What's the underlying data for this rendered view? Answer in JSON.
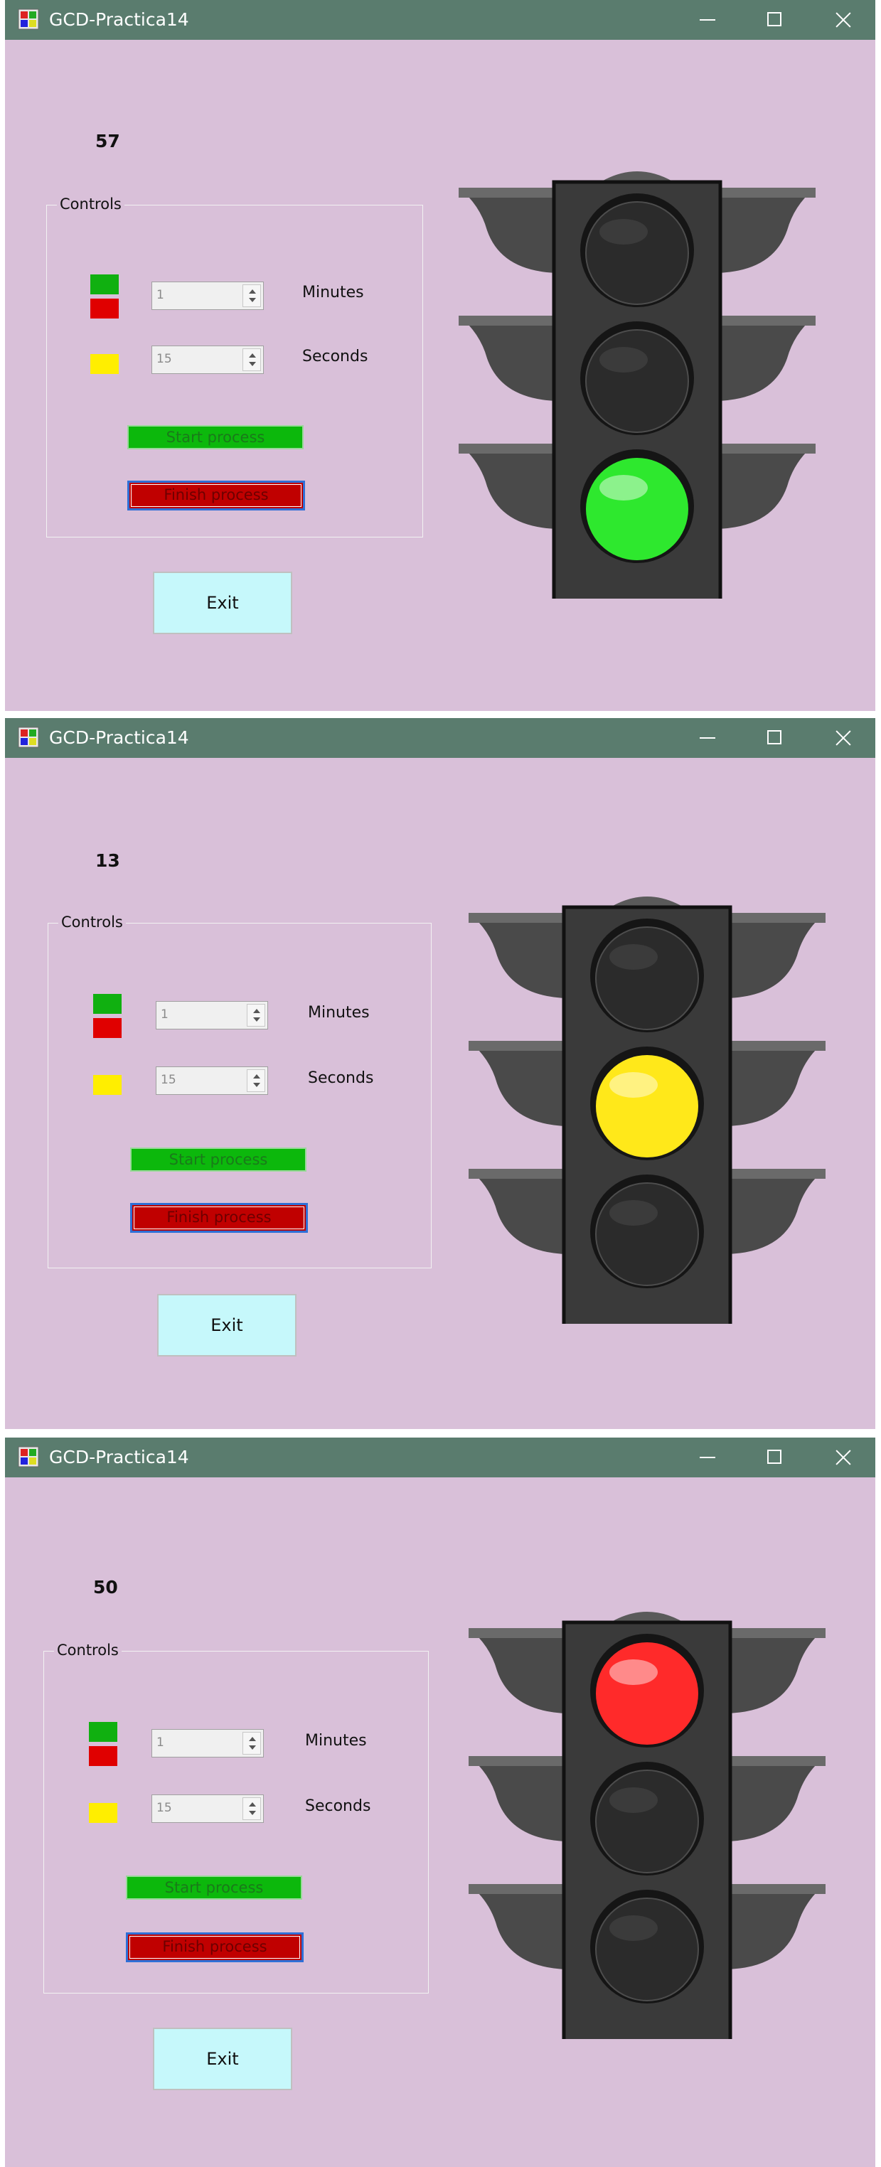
{
  "windows": [
    {
      "title": "GCD-Practica14",
      "counter": "57",
      "groupbox_label": "Controls",
      "minutes_value": "1",
      "minutes_label": "Minutes",
      "seconds_value": "15",
      "seconds_label": "Seconds",
      "start_label": "Start process",
      "finish_label": "Finish process",
      "exit_label": "Exit",
      "active_light": "green"
    },
    {
      "title": "GCD-Practica14",
      "counter": "13",
      "groupbox_label": "Controls",
      "minutes_value": "1",
      "minutes_label": "Minutes",
      "seconds_value": "15",
      "seconds_label": "Seconds",
      "start_label": "Start process",
      "finish_label": "Finish process",
      "exit_label": "Exit",
      "active_light": "yellow"
    },
    {
      "title": "GCD-Practica14",
      "counter": "50",
      "groupbox_label": "Controls",
      "minutes_value": "1",
      "minutes_label": "Minutes",
      "seconds_value": "15",
      "seconds_label": "Seconds",
      "start_label": "Start process",
      "finish_label": "Finish process",
      "exit_label": "Exit",
      "active_light": "red"
    }
  ],
  "colors": {
    "titlebar": "#5a7c6e",
    "window_bg": "#d9c0d9",
    "swatch_green": "#10b010",
    "swatch_red": "#e00000",
    "swatch_yellow": "#ffee00",
    "light_off": "#2b2b2b",
    "light_green": "#2ee82e",
    "light_yellow": "#ffe81a",
    "light_red": "#ff2a2a"
  }
}
